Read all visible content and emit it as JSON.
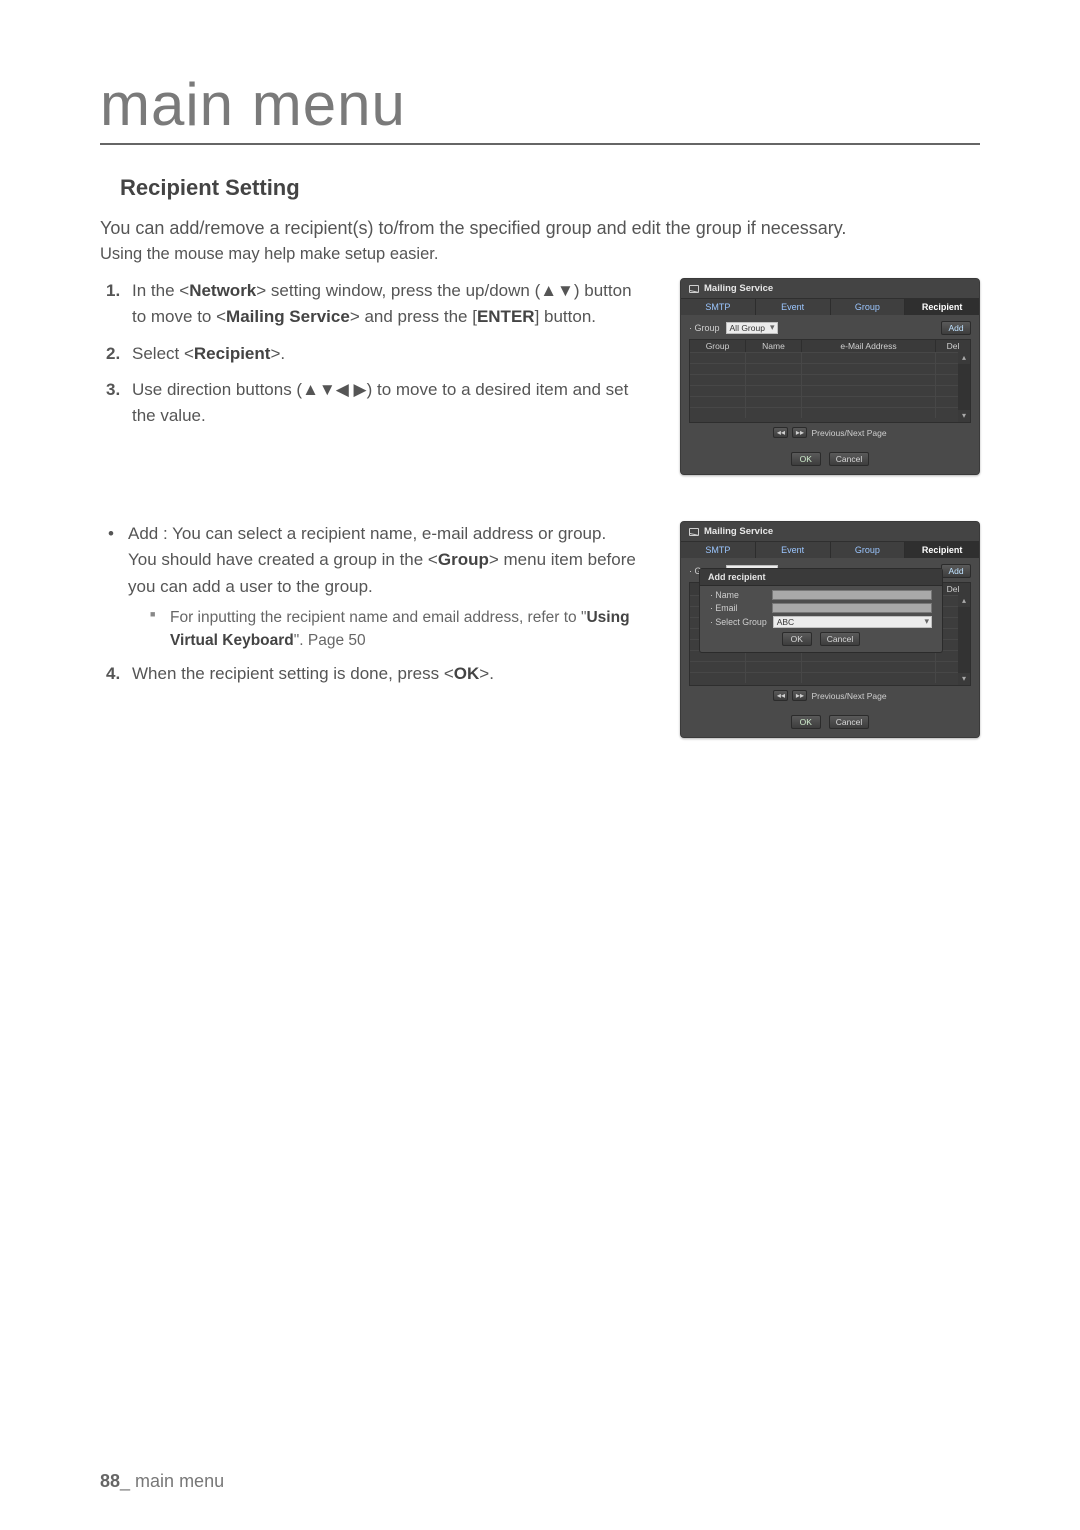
{
  "page": {
    "number": "88",
    "footer_label": "main menu",
    "main_title": "main menu"
  },
  "section": {
    "title": "Recipient Setting",
    "intro": "You can add/remove a recipient(s) to/from the specified group and edit the group if necessary.",
    "intro2": "Using the mouse may help make setup easier."
  },
  "steps": {
    "s1_a": "In the <",
    "s1_b": "Network",
    "s1_c": "> setting window, press the up/down (▲▼) button to move to <",
    "s1_d": "Mailing Service",
    "s1_e": "> and press the [",
    "s1_f": "ENTER",
    "s1_g": "] button.",
    "s2_a": "Select <",
    "s2_b": "Recipient",
    "s2_c": ">.",
    "s3": "Use direction buttons (▲▼◀ ▶) to move to a desired item and set the value."
  },
  "bullets": {
    "add_a": "Add : You can select a recipient name, e-mail address or group.",
    "add_b_a": "You should have created a group in the <",
    "add_b_b": "Group",
    "add_b_c": "> menu item before you can add a user to the group.",
    "sub_a": "For inputting the recipient name and email address, refer to \"",
    "sub_b": "Using Virtual Keyboard",
    "sub_c": "\". Page 50"
  },
  "step4_a": "When the recipient setting is done, press <",
  "step4_b": "OK",
  "step4_c": ">.",
  "ms": {
    "title": "Mailing Service",
    "tabs": {
      "smtp": "SMTP",
      "event": "Event",
      "group": "Group",
      "recipient": "Recipient"
    },
    "group_label": "· Group",
    "group_value_all": "All Group",
    "group_value_abc": "ABC",
    "addBtn": "Add",
    "delBtn": "Del",
    "th": {
      "group": "Group",
      "name": "Name",
      "mail": "e-Mail Address",
      "del": "Del"
    },
    "pager": "Previous/Next Page",
    "ok": "OK",
    "cancel": "Cancel"
  },
  "dialog": {
    "title": "Add recipient",
    "name": "· Name",
    "email": "· Email",
    "select_group": "· Select Group",
    "select_group_value": "ABC",
    "ok": "OK",
    "cancel": "Cancel"
  }
}
